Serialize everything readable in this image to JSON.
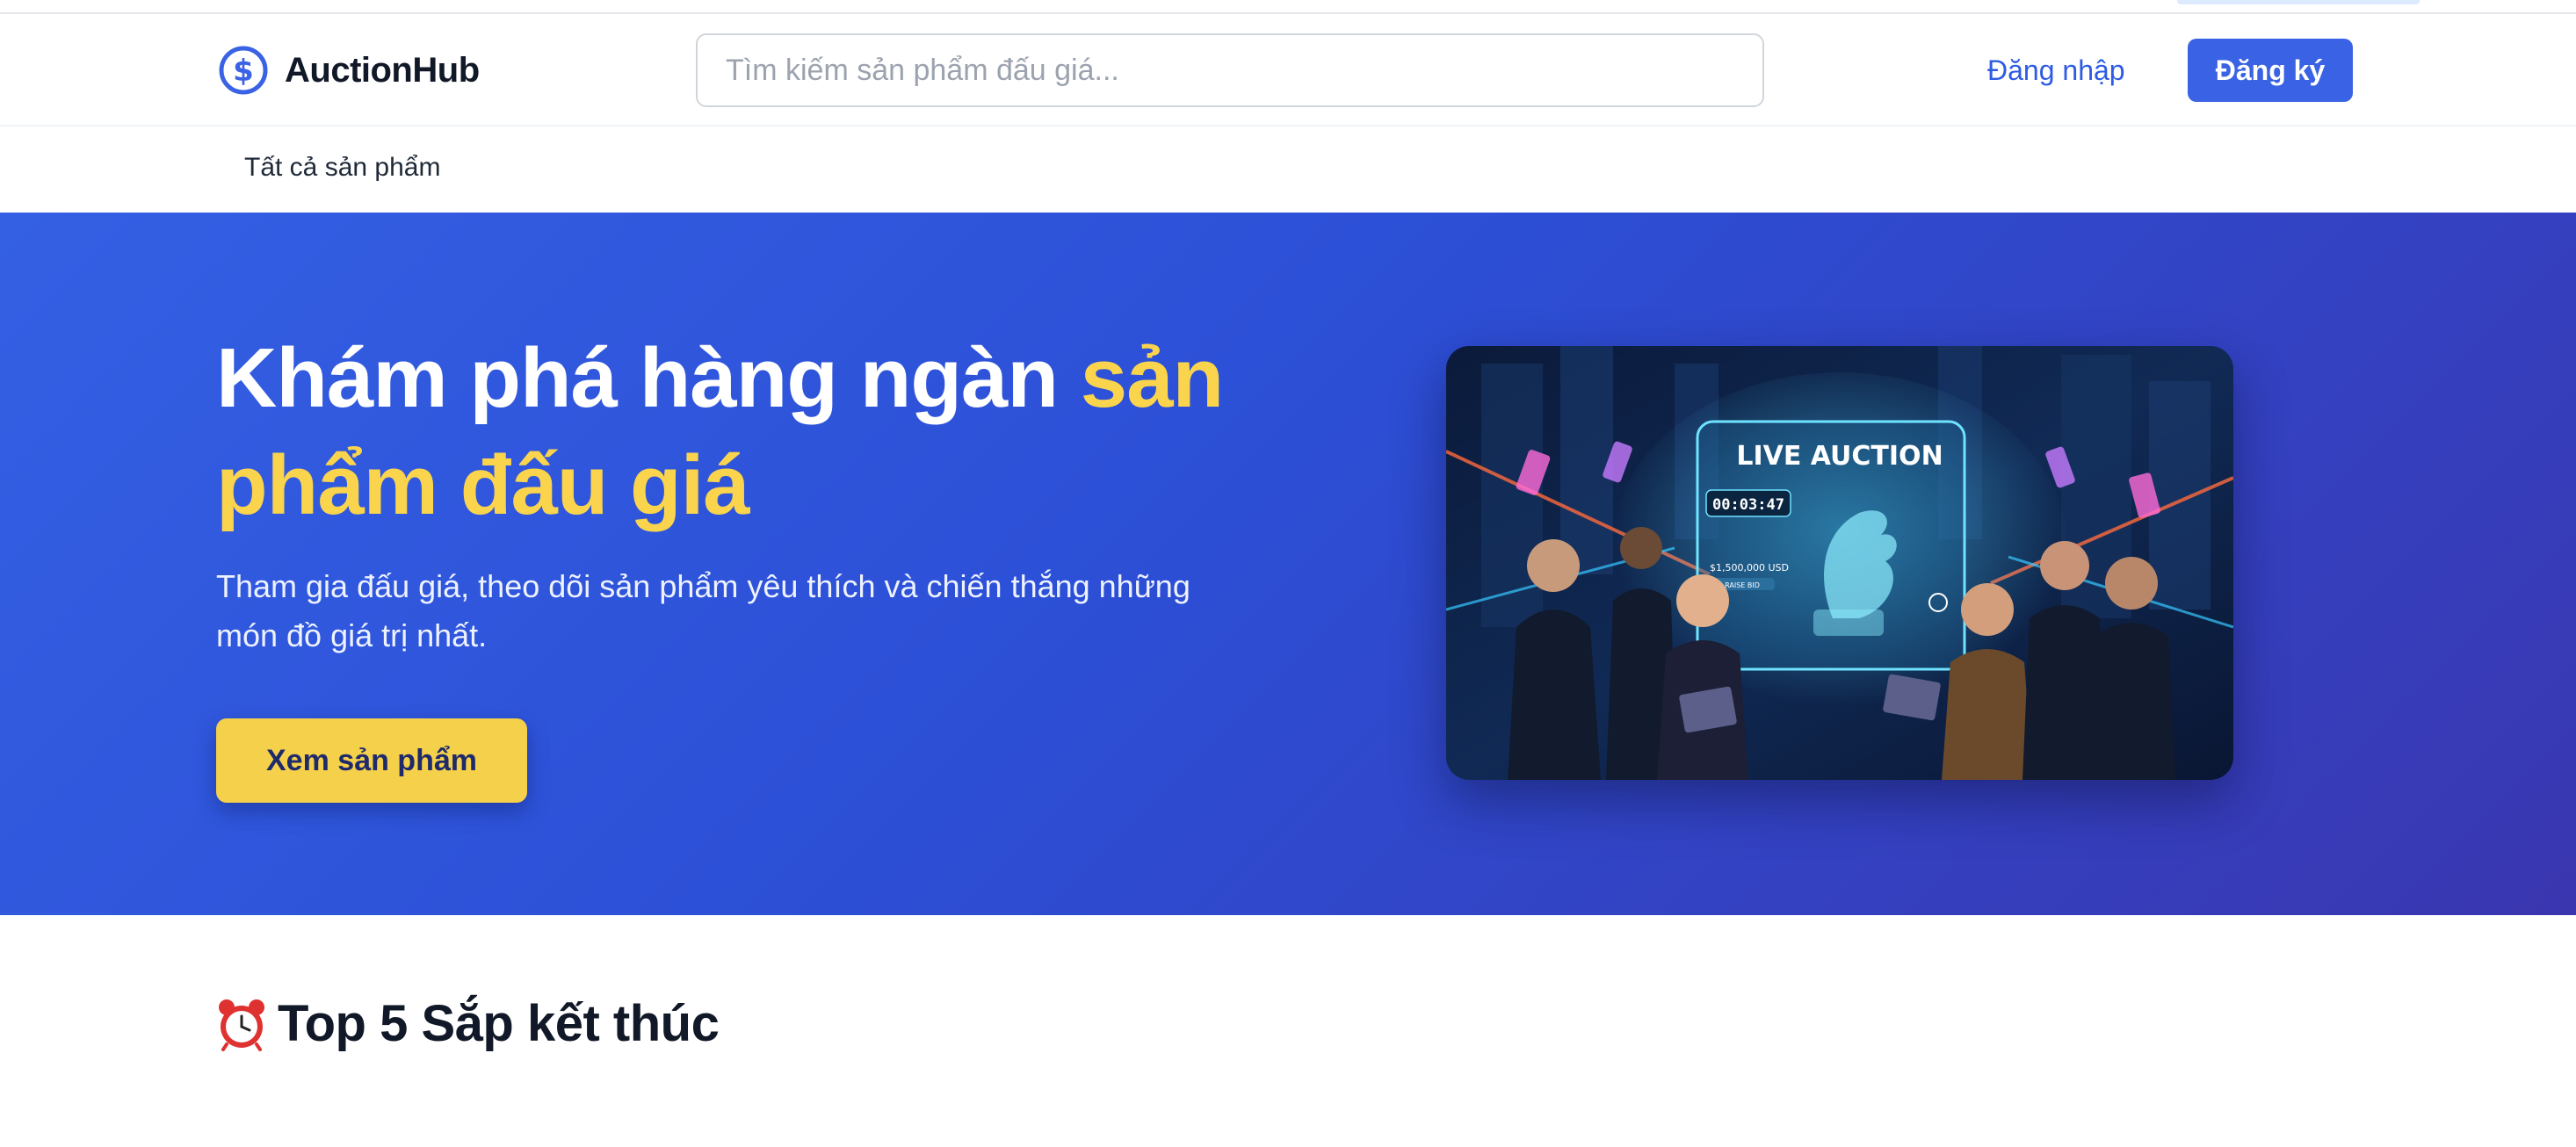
{
  "header": {
    "brand": "AuctionHub",
    "logo_icon": "dollar-circle-icon",
    "search_placeholder": "Tìm kiếm sản phẩm đấu giá...",
    "login_label": "Đăng nhập",
    "signup_label": "Đăng ký"
  },
  "subnav": {
    "items": [
      {
        "label": "Tất cả sản phẩm"
      }
    ]
  },
  "hero": {
    "title_part1": "Khám phá hàng ngàn ",
    "title_highlight": "sản phẩm đấu giá",
    "subtitle": "Tham gia đấu giá, theo dõi sản phẩm yêu thích và chiến thắng những món đồ giá trị nhất.",
    "cta_label": "Xem sản phẩm",
    "image": {
      "screen_title": "LIVE AUCTION",
      "timer": "00:03:47",
      "price": "$1,500,000 USD",
      "button_text": "RAISE BID"
    }
  },
  "section": {
    "icon": "alarm-clock-icon",
    "title": "Top 5 Sắp kết thúc"
  },
  "colors": {
    "brand_blue": "#3a62e4",
    "link_blue": "#2d5be3",
    "hero_gradient_start": "#3460e4",
    "hero_gradient_end": "#3a36b0",
    "accent_yellow": "#fbd44d",
    "cta_yellow": "#f5d04a"
  }
}
